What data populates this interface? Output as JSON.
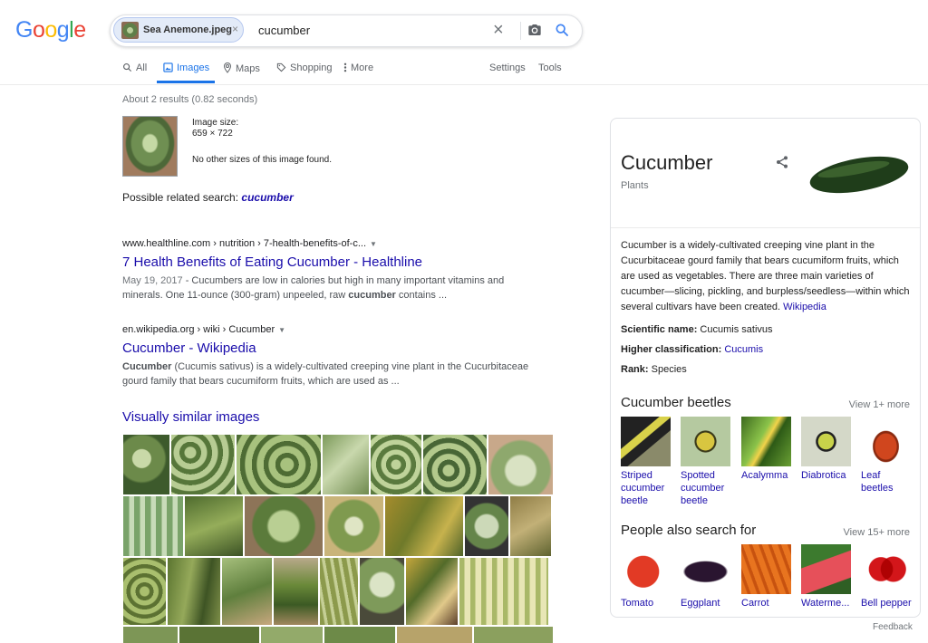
{
  "logo": {
    "letters": [
      "G",
      "o",
      "o",
      "g",
      "l",
      "e"
    ],
    "colors": [
      "#4285f4",
      "#ea4335",
      "#fbbc05",
      "#4285f4",
      "#34a853",
      "#ea4335"
    ]
  },
  "search": {
    "chip_label": "Sea Anemone.jpeg",
    "chip_close": "×",
    "query": "cucumber",
    "clear": "×"
  },
  "tabs": {
    "all": "All",
    "images": "Images",
    "maps": "Maps",
    "shopping": "Shopping",
    "more": "More",
    "settings": "Settings",
    "tools": "Tools"
  },
  "stats": "About 2 results (0.82 seconds)",
  "query_image": {
    "size_label": "Image size:",
    "dimensions": "659 × 722",
    "no_other": "No other sizes of this image found."
  },
  "related": {
    "label": "Possible related search:",
    "term": "cucumber"
  },
  "results": [
    {
      "cite": "www.healthline.com › nutrition › 7-health-benefits-of-c...",
      "title": "7 Health Benefits of Eating Cucumber - Healthline",
      "date": "May 19, 2017",
      "snippet_a": " - Cucumbers are low in calories but high in many important vitamins and minerals. One 11-ounce (300-gram) unpeeled, raw ",
      "snippet_bold": "cucumber",
      "snippet_b": " contains ..."
    },
    {
      "cite": "en.wikipedia.org › wiki › Cucumber",
      "title": "Cucumber - Wikipedia",
      "snippet_bold": "Cucumber",
      "snippet_a": " (Cucumis sativus) is a widely-cultivated creeping vine plant in the Cucurbitaceae gourd family that bears cucumiform fruits, which are used as ..."
    }
  ],
  "visually_similar": "Visually similar images",
  "knowledge_panel": {
    "title": "Cucumber",
    "subtitle": "Plants",
    "description": "Cucumber is a widely-cultivated creeping vine plant in the Cucurbitaceae gourd family that bears cucumiform fruits, which are used as vegetables. There are three main varieties of cucumber—slicing, pickling, and burpless/seedless—within which several cultivars have been created.",
    "description_link": "Wikipedia",
    "facts": [
      {
        "label": "Scientific name:",
        "value": "Cucumis sativus",
        "link": false
      },
      {
        "label": "Higher classification:",
        "value": "Cucumis",
        "link": true
      },
      {
        "label": "Rank:",
        "value": "Species",
        "link": false
      }
    ],
    "beetles_title": "Cucumber beetles",
    "beetles_more": "View 1+ more",
    "beetles": [
      "Striped cucumber beetle",
      "Spotted cucumber beetle",
      "Acalymma",
      "Diabrotica",
      "Leaf beetles"
    ],
    "also_title": "People also search for",
    "also_more": "View 15+ more",
    "also": [
      "Tomato",
      "Eggplant",
      "Carrot",
      "Waterme...",
      "Bell pepper"
    ]
  },
  "feedback": "Feedback"
}
